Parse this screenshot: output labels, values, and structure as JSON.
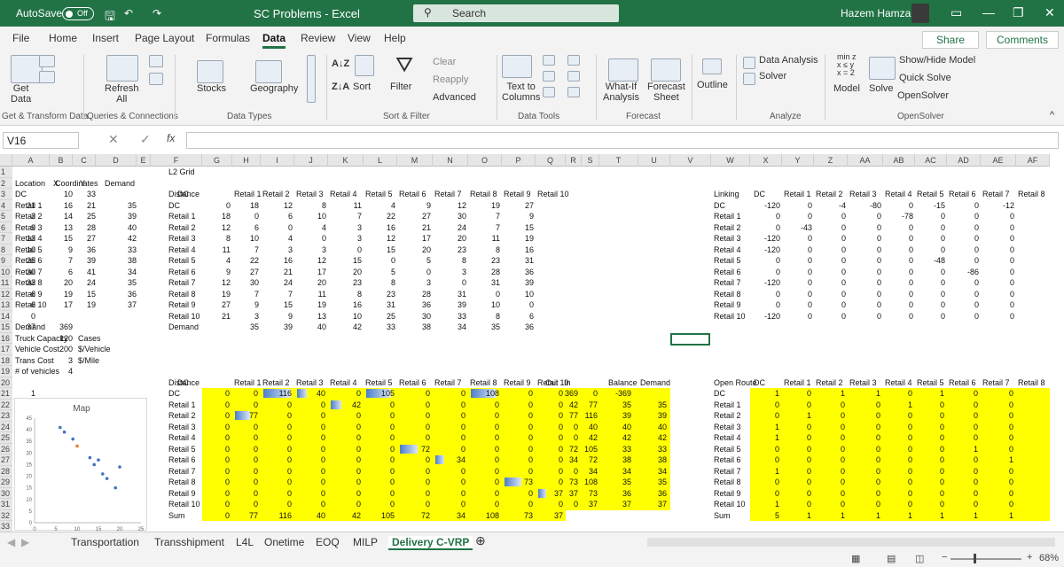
{
  "title": {
    "autosave": "AutoSave",
    "toggle": "Off",
    "doc": "SC Problems  -  Excel",
    "search": "Search",
    "user": "Hazem Hamza"
  },
  "menus": [
    "File",
    "Home",
    "Insert",
    "Page Layout",
    "Formulas",
    "Data",
    "Review",
    "View",
    "Help"
  ],
  "share": "Share",
  "comments": "Comments",
  "ribbon": {
    "get_data": "Get\nData",
    "refresh": "Refresh\nAll",
    "stocks": "Stocks",
    "geography": "Geography",
    "clear": "Clear",
    "reapply": "Reapply",
    "advanced": "Advanced",
    "sort": "Sort",
    "filter": "Filter",
    "text_to_columns": "Text to\nColumns",
    "what_if": "What-If\nAnalysis",
    "forecast_sheet": "Forecast\nSheet",
    "outline": "Outline",
    "data_analysis": "Data Analysis",
    "solver": "Solver",
    "model": "Model",
    "solve": "Solve",
    "show_hide_model": "Show/Hide Model",
    "quick_solve": "Quick Solve",
    "opensolver_btn": "OpenSolver",
    "groups": [
      "Get & Transform Data",
      "Queries & Connections",
      "Data Types",
      "Sort & Filter",
      "Data Tools",
      "Forecast",
      "Analyze",
      "OpenSolver"
    ]
  },
  "namebox": "V16",
  "columns": [
    "A",
    "B",
    "C",
    "D",
    "E",
    "F",
    "G",
    "H",
    "I",
    "J",
    "K",
    "L",
    "M",
    "N",
    "O",
    "P",
    "Q",
    "R",
    "S",
    "T",
    "U",
    "V",
    "W",
    "X",
    "Y",
    "Z",
    "AA",
    "AB",
    "AC",
    "AD",
    "AE",
    "AF"
  ],
  "rows": [
    "1",
    "2",
    "3",
    "4",
    "5",
    "6",
    "7",
    "8",
    "9",
    "10",
    "11",
    "12",
    "13",
    "14",
    "15",
    "16",
    "17",
    "18",
    "19",
    "20",
    "21",
    "22",
    "23",
    "24",
    "25",
    "26",
    "27",
    "28",
    "29",
    "30",
    "31",
    "32",
    "33"
  ],
  "coords": {
    "header": "Coordinates",
    "headers": [
      "Location",
      "X",
      "Y",
      "Demand"
    ],
    "rows": [
      [
        "DC",
        "10",
        "33",
        ""
      ],
      [
        "Retail 1",
        "16",
        "21",
        "35"
      ],
      [
        "Retail 2",
        "14",
        "25",
        "39"
      ],
      [
        "Retail 3",
        "13",
        "28",
        "40"
      ],
      [
        "Retail 4",
        "15",
        "27",
        "42"
      ],
      [
        "Retail 5",
        "9",
        "36",
        "33"
      ],
      [
        "Retail 6",
        "7",
        "39",
        "38"
      ],
      [
        "Retail 7",
        "6",
        "41",
        "34"
      ],
      [
        "Retail 8",
        "20",
        "24",
        "35"
      ],
      [
        "Retail 9",
        "19",
        "15",
        "36"
      ],
      [
        "Retail 10",
        "17",
        "19",
        "37"
      ]
    ],
    "extras": [
      [
        "Demand",
        "369",
        ""
      ],
      [
        "Truck Capacity",
        "120",
        "Cases"
      ],
      [
        "Vehicle Cost",
        "200",
        "$/Vehicle"
      ],
      [
        "Trans Cost",
        "3",
        "$/Mile"
      ],
      [
        "# of vehicles",
        "4",
        ""
      ]
    ]
  },
  "l2": {
    "title": "L2 Grid",
    "headers": [
      "Distance",
      "DC",
      "Retail 1",
      "Retail 2",
      "Retail 3",
      "Retail 4",
      "Retail 5",
      "Retail 6",
      "Retail 7",
      "Retail 8",
      "Retail 9",
      "Retail 10"
    ],
    "rows": [
      [
        "DC",
        "0",
        "18",
        "12",
        "8",
        "11",
        "4",
        "9",
        "12",
        "19",
        "27",
        "21"
      ],
      [
        "Retail 1",
        "18",
        "0",
        "6",
        "10",
        "7",
        "22",
        "27",
        "30",
        "7",
        "9",
        "3"
      ],
      [
        "Retail 2",
        "12",
        "6",
        "0",
        "4",
        "3",
        "16",
        "21",
        "24",
        "7",
        "15",
        "9"
      ],
      [
        "Retail 3",
        "8",
        "10",
        "4",
        "0",
        "3",
        "12",
        "17",
        "20",
        "11",
        "19",
        "13"
      ],
      [
        "Retail 4",
        "11",
        "7",
        "3",
        "3",
        "0",
        "15",
        "20",
        "23",
        "8",
        "16",
        "10"
      ],
      [
        "Retail 5",
        "4",
        "22",
        "16",
        "12",
        "15",
        "0",
        "5",
        "8",
        "23",
        "31",
        "25"
      ],
      [
        "Retail 6",
        "9",
        "27",
        "21",
        "17",
        "20",
        "5",
        "0",
        "3",
        "28",
        "36",
        "30"
      ],
      [
        "Retail 7",
        "12",
        "30",
        "24",
        "20",
        "23",
        "8",
        "3",
        "0",
        "31",
        "39",
        "33"
      ],
      [
        "Retail 8",
        "19",
        "7",
        "7",
        "11",
        "8",
        "23",
        "28",
        "31",
        "0",
        "10",
        "6"
      ],
      [
        "Retail 9",
        "27",
        "9",
        "15",
        "19",
        "16",
        "31",
        "36",
        "39",
        "10",
        "0",
        "6"
      ],
      [
        "Retail 10",
        "21",
        "3",
        "9",
        "13",
        "10",
        "25",
        "30",
        "33",
        "8",
        "6",
        "0"
      ],
      [
        "Demand",
        "",
        "35",
        "39",
        "40",
        "42",
        "33",
        "38",
        "34",
        "35",
        "36",
        "37"
      ]
    ]
  },
  "linking": {
    "headers": [
      "Linking",
      "DC",
      "Retail 1",
      "Retail 2",
      "Retail 3",
      "Retail 4",
      "Retail 5",
      "Retail 6",
      "Retail 7",
      "Retail 8"
    ],
    "rows": [
      [
        "DC",
        "-120",
        "0",
        "-4",
        "-80",
        "0",
        "-15",
        "0",
        "-12"
      ],
      [
        "Retail 1",
        "0",
        "0",
        "0",
        "0",
        "-78",
        "0",
        "0",
        "0"
      ],
      [
        "Retail 2",
        "0",
        "-43",
        "0",
        "0",
        "0",
        "0",
        "0",
        "0"
      ],
      [
        "Retail 3",
        "-120",
        "0",
        "0",
        "0",
        "0",
        "0",
        "0",
        "0"
      ],
      [
        "Retail 4",
        "-120",
        "0",
        "0",
        "0",
        "0",
        "0",
        "0",
        "0"
      ],
      [
        "Retail 5",
        "0",
        "0",
        "0",
        "0",
        "0",
        "-48",
        "0",
        "0"
      ],
      [
        "Retail 6",
        "0",
        "0",
        "0",
        "0",
        "0",
        "0",
        "-86",
        "0"
      ],
      [
        "Retail 7",
        "-120",
        "0",
        "0",
        "0",
        "0",
        "0",
        "0",
        "0"
      ],
      [
        "Retail 8",
        "0",
        "0",
        "0",
        "0",
        "0",
        "0",
        "0",
        "0"
      ],
      [
        "Retail 9",
        "0",
        "0",
        "0",
        "0",
        "0",
        "0",
        "0",
        "0"
      ],
      [
        "Retail 10",
        "-120",
        "0",
        "0",
        "0",
        "0",
        "0",
        "0",
        "0"
      ]
    ]
  },
  "flow": {
    "headers": [
      "Distance",
      "DC",
      "Retail 1",
      "Retail 2",
      "Retail 3",
      "Retail 4",
      "Retail 5",
      "Retail 6",
      "Retail 7",
      "Retail 8",
      "Retail 9",
      "Retail 10",
      "Out",
      "In",
      "Balance",
      "Demand"
    ],
    "rows": [
      [
        "DC",
        "0",
        "0",
        "116",
        "40",
        "0",
        "105",
        "0",
        "0",
        "108",
        "0",
        "0",
        "369",
        "0",
        "-369",
        ""
      ],
      [
        "Retail 1",
        "0",
        "0",
        "0",
        "0",
        "42",
        "0",
        "0",
        "0",
        "0",
        "0",
        "0",
        "42",
        "77",
        "35",
        "35"
      ],
      [
        "Retail 2",
        "0",
        "77",
        "0",
        "0",
        "0",
        "0",
        "0",
        "0",
        "0",
        "0",
        "0",
        "77",
        "116",
        "39",
        "39"
      ],
      [
        "Retail 3",
        "0",
        "0",
        "0",
        "0",
        "0",
        "0",
        "0",
        "0",
        "0",
        "0",
        "0",
        "0",
        "40",
        "40",
        "40"
      ],
      [
        "Retail 4",
        "0",
        "0",
        "0",
        "0",
        "0",
        "0",
        "0",
        "0",
        "0",
        "0",
        "0",
        "0",
        "42",
        "42",
        "42"
      ],
      [
        "Retail 5",
        "0",
        "0",
        "0",
        "0",
        "0",
        "0",
        "72",
        "0",
        "0",
        "0",
        "0",
        "72",
        "105",
        "33",
        "33"
      ],
      [
        "Retail 6",
        "0",
        "0",
        "0",
        "0",
        "0",
        "0",
        "0",
        "34",
        "0",
        "0",
        "0",
        "34",
        "72",
        "38",
        "38"
      ],
      [
        "Retail 7",
        "0",
        "0",
        "0",
        "0",
        "0",
        "0",
        "0",
        "0",
        "0",
        "0",
        "0",
        "0",
        "34",
        "34",
        "34"
      ],
      [
        "Retail 8",
        "0",
        "0",
        "0",
        "0",
        "0",
        "0",
        "0",
        "0",
        "0",
        "73",
        "0",
        "73",
        "108",
        "35",
        "35"
      ],
      [
        "Retail 9",
        "0",
        "0",
        "0",
        "0",
        "0",
        "0",
        "0",
        "0",
        "0",
        "0",
        "37",
        "37",
        "73",
        "36",
        "36"
      ],
      [
        "Retail 10",
        "0",
        "0",
        "0",
        "0",
        "0",
        "0",
        "0",
        "0",
        "0",
        "0",
        "0",
        "0",
        "37",
        "37",
        "37"
      ],
      [
        "Sum",
        "0",
        "77",
        "116",
        "40",
        "42",
        "105",
        "72",
        "34",
        "108",
        "73",
        "37",
        "",
        "",
        "",
        ""
      ]
    ],
    "max": 120
  },
  "route": {
    "headers": [
      "Open Route",
      "DC",
      "Retail 1",
      "Retail 2",
      "Retail 3",
      "Retail 4",
      "Retail 5",
      "Retail 6",
      "Retail 7",
      "Retail 8"
    ],
    "rows": [
      [
        "DC",
        "1",
        "0",
        "1",
        "1",
        "0",
        "1",
        "0",
        "0",
        "1"
      ],
      [
        "Retail 1",
        "0",
        "0",
        "0",
        "0",
        "1",
        "0",
        "0",
        "0",
        "0"
      ],
      [
        "Retail 2",
        "0",
        "1",
        "0",
        "0",
        "0",
        "0",
        "0",
        "0",
        "0"
      ],
      [
        "Retail 3",
        "1",
        "0",
        "0",
        "0",
        "0",
        "0",
        "0",
        "0",
        "0"
      ],
      [
        "Retail 4",
        "1",
        "0",
        "0",
        "0",
        "0",
        "0",
        "0",
        "0",
        "0"
      ],
      [
        "Retail 5",
        "0",
        "0",
        "0",
        "0",
        "0",
        "0",
        "1",
        "0",
        "0"
      ],
      [
        "Retail 6",
        "0",
        "0",
        "0",
        "0",
        "0",
        "0",
        "0",
        "1",
        "0"
      ],
      [
        "Retail 7",
        "1",
        "0",
        "0",
        "0",
        "0",
        "0",
        "0",
        "0",
        "0"
      ],
      [
        "Retail 8",
        "0",
        "0",
        "0",
        "0",
        "0",
        "0",
        "0",
        "0",
        "0"
      ],
      [
        "Retail 9",
        "0",
        "0",
        "0",
        "0",
        "0",
        "0",
        "0",
        "0",
        "0"
      ],
      [
        "Retail 10",
        "1",
        "0",
        "0",
        "0",
        "0",
        "0",
        "0",
        "0",
        "0"
      ],
      [
        "Sum",
        "5",
        "1",
        "1",
        "1",
        "1",
        "1",
        "1",
        "1",
        "1"
      ]
    ]
  },
  "chart_data": {
    "type": "scatter",
    "title": "Map",
    "xlabel": "",
    "ylabel": "",
    "xlim": [
      0,
      25
    ],
    "ylim": [
      0,
      45
    ],
    "xticks": [
      "0",
      "5",
      "10",
      "15",
      "20",
      "25"
    ],
    "yticks": [
      "0",
      "5",
      "10",
      "15",
      "20",
      "25",
      "30",
      "35",
      "40",
      "45"
    ],
    "series": [
      {
        "color": "#4472c4",
        "points": [
          [
            16,
            21
          ],
          [
            14,
            25
          ],
          [
            13,
            28
          ],
          [
            15,
            27
          ],
          [
            9,
            36
          ],
          [
            7,
            39
          ],
          [
            6,
            41
          ],
          [
            20,
            24
          ],
          [
            19,
            15
          ],
          [
            17,
            19
          ]
        ]
      },
      {
        "color": "#ed7d31",
        "points": [
          [
            10,
            33
          ]
        ]
      }
    ]
  },
  "sheets": [
    "Transportation",
    "Transshipment",
    "L4L",
    "Onetime",
    "EOQ",
    "MILP",
    "Delivery C-VRP"
  ],
  "active_sheet": "Delivery C-VRP",
  "zoom": "68%"
}
